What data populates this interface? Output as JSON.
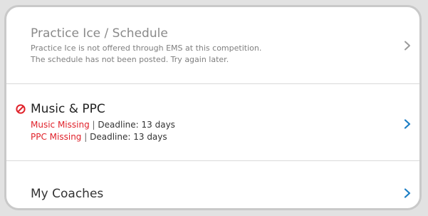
{
  "practice_ice": {
    "title": "Practice Ice / Schedule",
    "line1": "Practice Ice is not offered through EMS at this competition.",
    "line2": "The schedule has not been posted. Try again later.",
    "chevron_color": "#9a9a9a",
    "icon": "chevron-right-icon"
  },
  "music_ppc": {
    "title": "Music & PPC",
    "status_icon": "ban-icon",
    "status_icon_color": "#e0212a",
    "music": {
      "label": "Music Missing",
      "separator": "|",
      "deadline": "Deadline: 13 days"
    },
    "ppc": {
      "label": "PPC Missing",
      "separator": "|",
      "deadline": "Deadline: 13 days"
    },
    "chevron_color": "#1c7ec4",
    "icon": "chevron-right-icon"
  },
  "coaches": {
    "title": "My Coaches",
    "chevron_color": "#1c7ec4",
    "icon": "chevron-right-icon"
  },
  "colors": {
    "missing": "#e0212a",
    "accent": "#1c7ec4",
    "disabled_text": "#8a8a8a"
  }
}
